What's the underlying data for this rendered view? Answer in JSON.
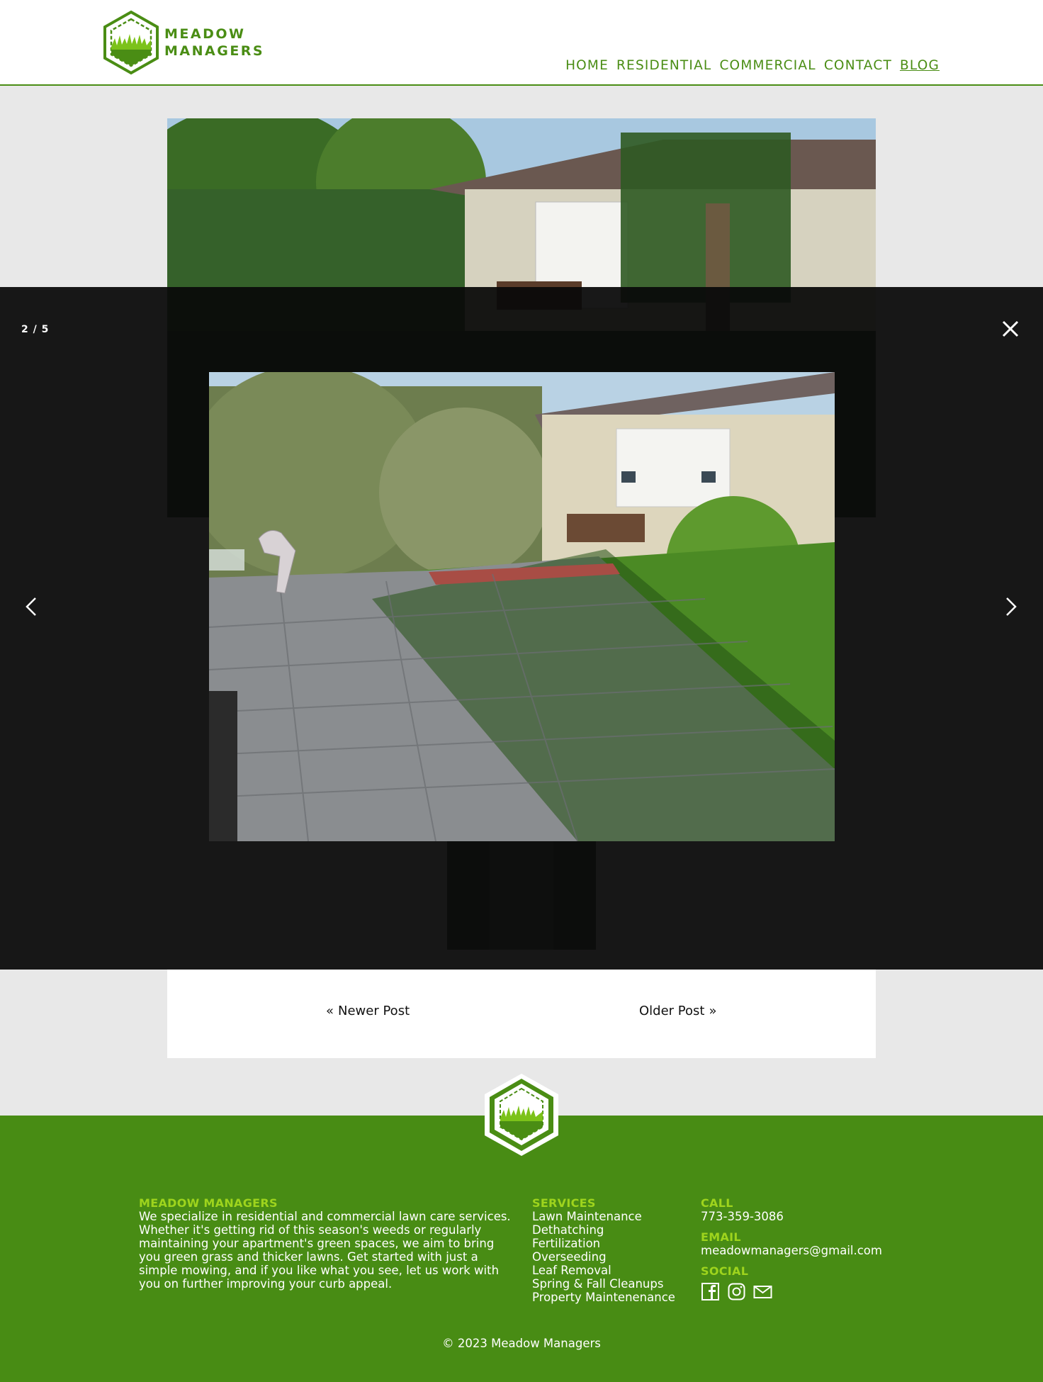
{
  "header": {
    "brand_line1": "MEADOW",
    "brand_line2": "MANAGERS",
    "nav": [
      {
        "label": "HOME"
      },
      {
        "label": "RESIDENTIAL"
      },
      {
        "label": "COMMERCIAL"
      },
      {
        "label": "CONTACT"
      },
      {
        "label": "BLOG",
        "active": true
      }
    ]
  },
  "post": {
    "newer_label": "Newer Post",
    "older_label": "Older Post"
  },
  "lightbox": {
    "counter": "2 / 5",
    "close_icon": "close-icon",
    "prev_icon": "chevron-left-icon",
    "next_icon": "chevron-right-icon"
  },
  "footer": {
    "about_title": "MEADOW MANAGERS",
    "about_text": "We specialize in residential and commercial lawn care services. Whether it's getting rid of this season's weeds or regularly maintaining your apartment's green spaces, we aim to bring you green grass and thicker lawns. Get started with just a simple mowing, and if you like what you see, let us work with you on further improving your curb appeal.",
    "services_title": "SERVICES",
    "services": [
      "Lawn Maintenance",
      "Dethatching",
      "Fertilization",
      "Overseeding",
      "Leaf Removal",
      "Spring & Fall Cleanups",
      "Property Maintenenance"
    ],
    "call_title": "CALL",
    "phone": "773-359-3086",
    "email_title": "EMAIL",
    "email": "meadowmanagers@gmail.com",
    "social_title": "SOCIAL",
    "social_icons": [
      "facebook-icon",
      "instagram-icon",
      "mail-icon"
    ],
    "copyright": "© 2023 Meadow Managers"
  },
  "colors": {
    "brand_green": "#4a8d14",
    "footer_green": "#488c14",
    "accent_lime": "#9ed41d",
    "overlay": "#141414"
  }
}
